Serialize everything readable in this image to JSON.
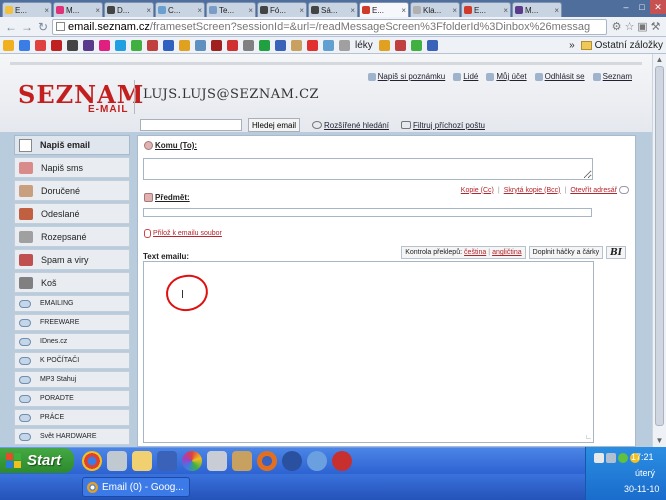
{
  "browser": {
    "tabs": [
      {
        "label": "E...",
        "color": "#f0c040"
      },
      {
        "label": "M...",
        "color": "#e0307a"
      },
      {
        "label": "D...",
        "color": "#444444"
      },
      {
        "label": "C...",
        "color": "#6aa0d0"
      },
      {
        "label": "Te...",
        "color": "#7a9cc8"
      },
      {
        "label": "Fó...",
        "color": "#444444"
      },
      {
        "label": "Sá...",
        "color": "#444444"
      },
      {
        "label": "E...",
        "color": "#d03a2a"
      },
      {
        "label": "Kla...",
        "color": "#b0b0b0"
      },
      {
        "label": "E...",
        "color": "#d03a2a"
      },
      {
        "label": "M...",
        "color": "#5a3a8a"
      }
    ],
    "active_tab_index": 7,
    "url_host": "email.seznam.cz",
    "url_path": "/framesetScreen?sessionId=&url=/readMessageScreen%3FfolderId%3Dinbox%26messag",
    "bookmarks_right_label": "Ostatní záložky",
    "bookmark_label": "léky"
  },
  "header": {
    "logo_main": "SEZNAM",
    "logo_sub": "E-MAIL",
    "user_email": "LUJS.LUJS@SEZNAM.CZ",
    "links": [
      "Napiš si poznámku",
      "Lidé",
      "Můj účet",
      "Odhlásit se",
      "Seznam"
    ],
    "search_button": "Hledej email",
    "advanced_search": "Rozšířené hledání",
    "filter_incoming": "Filtruj příchozí poštu"
  },
  "sidebar": {
    "compose": "Napiš email",
    "items": [
      {
        "label": "Napiš sms",
        "icon": "sms-icon",
        "color": "#d98a8a"
      },
      {
        "label": "Doručené",
        "icon": "inbox-icon",
        "color": "#c8a080"
      },
      {
        "label": "Odeslané",
        "icon": "sent-icon",
        "color": "#c06040"
      },
      {
        "label": "Rozepsané",
        "icon": "drafts-icon",
        "color": "#a0a0a0"
      },
      {
        "label": "Spam a viry",
        "icon": "spam-icon",
        "color": "#c05050"
      },
      {
        "label": "Koš",
        "icon": "trash-icon",
        "color": "#808080"
      }
    ],
    "folders": [
      "EMAILING",
      "FREEWARE",
      "IDnes.cz",
      "K POČÍTAČI",
      "MP3 Stahuj",
      "PORADTE",
      "PRÁCE",
      "Svět HARDWARE"
    ]
  },
  "compose_form": {
    "to_label": "Komu (To):",
    "cc_link": "Kopie (Cc)",
    "bcc_link": "Skrytá kopie (Bcc)",
    "addressbook_link": "Otevřít adresář",
    "subject_label": "Předmět:",
    "attach_link": "Přilož k emailu soubor",
    "body_label": "Text emailu:",
    "spellcheck_label": "Kontrola překlepů:",
    "lang_cs": "čeština",
    "lang_en": "angličtina",
    "diacritics_button": "Doplnit háčky a čárky",
    "format_button": "BI"
  },
  "taskbar": {
    "start_label": "Start",
    "window_label": "Email (0) - Goog...",
    "time": "17:21",
    "day": "úterý",
    "date": "30-11-10"
  }
}
